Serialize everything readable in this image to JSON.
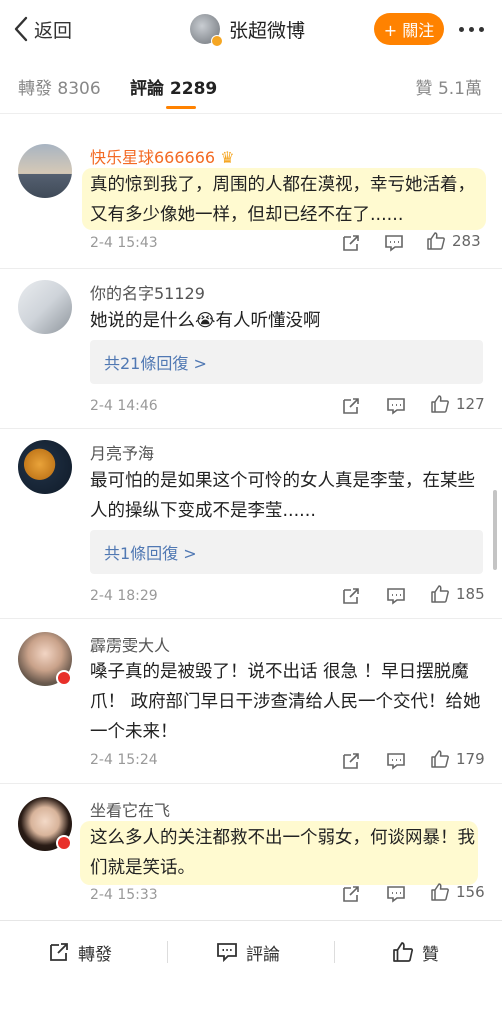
{
  "nav": {
    "back_label": "返回",
    "title": "张超微博",
    "follow_label": "+ 關注"
  },
  "tabs": {
    "repost": "轉發 8306",
    "comment": "評論 2289",
    "like": "贊 5.1萬"
  },
  "comments": [
    {
      "name": "快乐星球666666",
      "text": "真的惊到我了，周围的人都在漠视，幸亏她活着，又有多少像她一样，但却已经不在了......",
      "time": "2-4 15:43",
      "likes": "283"
    },
    {
      "name": "你的名字51129",
      "text": "她说的是什么😭有人听懂没啊",
      "reply": "共21條回復 >",
      "time": "2-4 14:46",
      "likes": "127"
    },
    {
      "name": "月亮予海",
      "text": "最可怕的是如果这个可怜的女人真是李莹，在某些人的操纵下变成不是李莹......",
      "reply": "共1條回復 >",
      "time": "2-4 18:29",
      "likes": "185"
    },
    {
      "name": "霹雳雯大人",
      "text": "嗓子真的是被毁了！说不出话 很急 ！早日摆脱魔爪！ 政府部门早日干涉查清给人民一个交代！给她一个未来！",
      "time": "2-4 15:24",
      "likes": "179"
    },
    {
      "name": "坐看它在飞",
      "text": "这么多人的关注都救不出一个弱女，何谈网暴！我们就是笑话。",
      "time": "2-4 15:33",
      "likes": "156"
    }
  ],
  "bottom": {
    "repost": "轉發",
    "comment": "評論",
    "like": "贊"
  },
  "colors": {
    "accent": "#ff8200",
    "link": "#5078b3",
    "highlight": "#fffad0"
  }
}
